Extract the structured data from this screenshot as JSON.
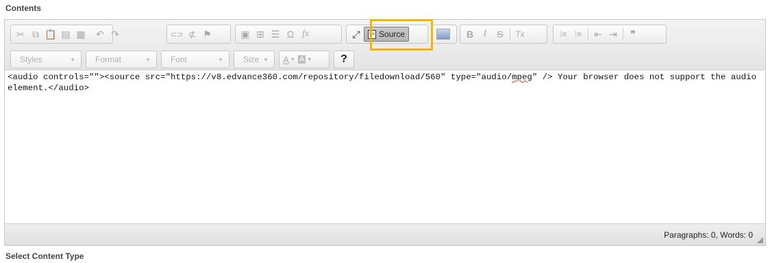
{
  "labels": {
    "contents": "Contents",
    "select_content_type": "Select Content Type"
  },
  "toolbar": {
    "row1": [
      {
        "name": "cut-icon",
        "glyph": "✂"
      },
      {
        "name": "copy-icon",
        "glyph": "⧉"
      },
      {
        "name": "paste-icon",
        "glyph": "📋"
      },
      {
        "name": "paste-text-icon",
        "glyph": "▤"
      },
      {
        "name": "paste-word-icon",
        "glyph": "▦"
      },
      {
        "name": "undo-icon",
        "glyph": "↶"
      },
      {
        "name": "redo-icon",
        "glyph": "↷"
      },
      {
        "name": "link-icon",
        "glyph": "⊂⊃"
      },
      {
        "name": "unlink-icon",
        "glyph": "⊄"
      },
      {
        "name": "anchor-icon",
        "glyph": "⚑"
      },
      {
        "name": "image-icon",
        "glyph": "▣"
      },
      {
        "name": "table-icon",
        "glyph": "⊞"
      },
      {
        "name": "horizontal-line-icon",
        "glyph": "☰"
      },
      {
        "name": "special-char-icon",
        "glyph": "Ω"
      },
      {
        "name": "formula-icon",
        "glyph": "fx"
      },
      {
        "name": "maximize-icon",
        "glyph": "⤢"
      },
      {
        "name": "background-image-icon",
        "glyph": "▬"
      },
      {
        "name": "bold-icon",
        "glyph": "B"
      },
      {
        "name": "italic-icon",
        "glyph": "I"
      },
      {
        "name": "strike-icon",
        "glyph": "S"
      },
      {
        "name": "remove-format-icon",
        "glyph": "Tx"
      },
      {
        "name": "numbered-list-icon",
        "glyph": "⁝≡"
      },
      {
        "name": "bulleted-list-icon",
        "glyph": "⁞≡"
      },
      {
        "name": "outdent-icon",
        "glyph": "⇤"
      },
      {
        "name": "indent-icon",
        "glyph": "⇥"
      },
      {
        "name": "blockquote-icon",
        "glyph": "❞"
      }
    ],
    "source_label": "Source",
    "styles_label": "Styles",
    "format_label": "Format",
    "font_label": "Font",
    "size_label": "Size",
    "text_color_glyph": "A",
    "bg_color_glyph": "A",
    "help_glyph": "?"
  },
  "source_text": {
    "before": "<audio controls=\"\"><source src=\"https://v8.edvance360.com/repository/filedownload/560\" type=\"audio/",
    "misspelled": "mpeg",
    "after": "\" /> Your browser does not support the audio element.</audio>"
  },
  "status": {
    "path_info": "Paragraphs: 0, Words: 0"
  },
  "colors": {
    "highlight": "#f2b705",
    "spellcheck": "#e03030"
  }
}
